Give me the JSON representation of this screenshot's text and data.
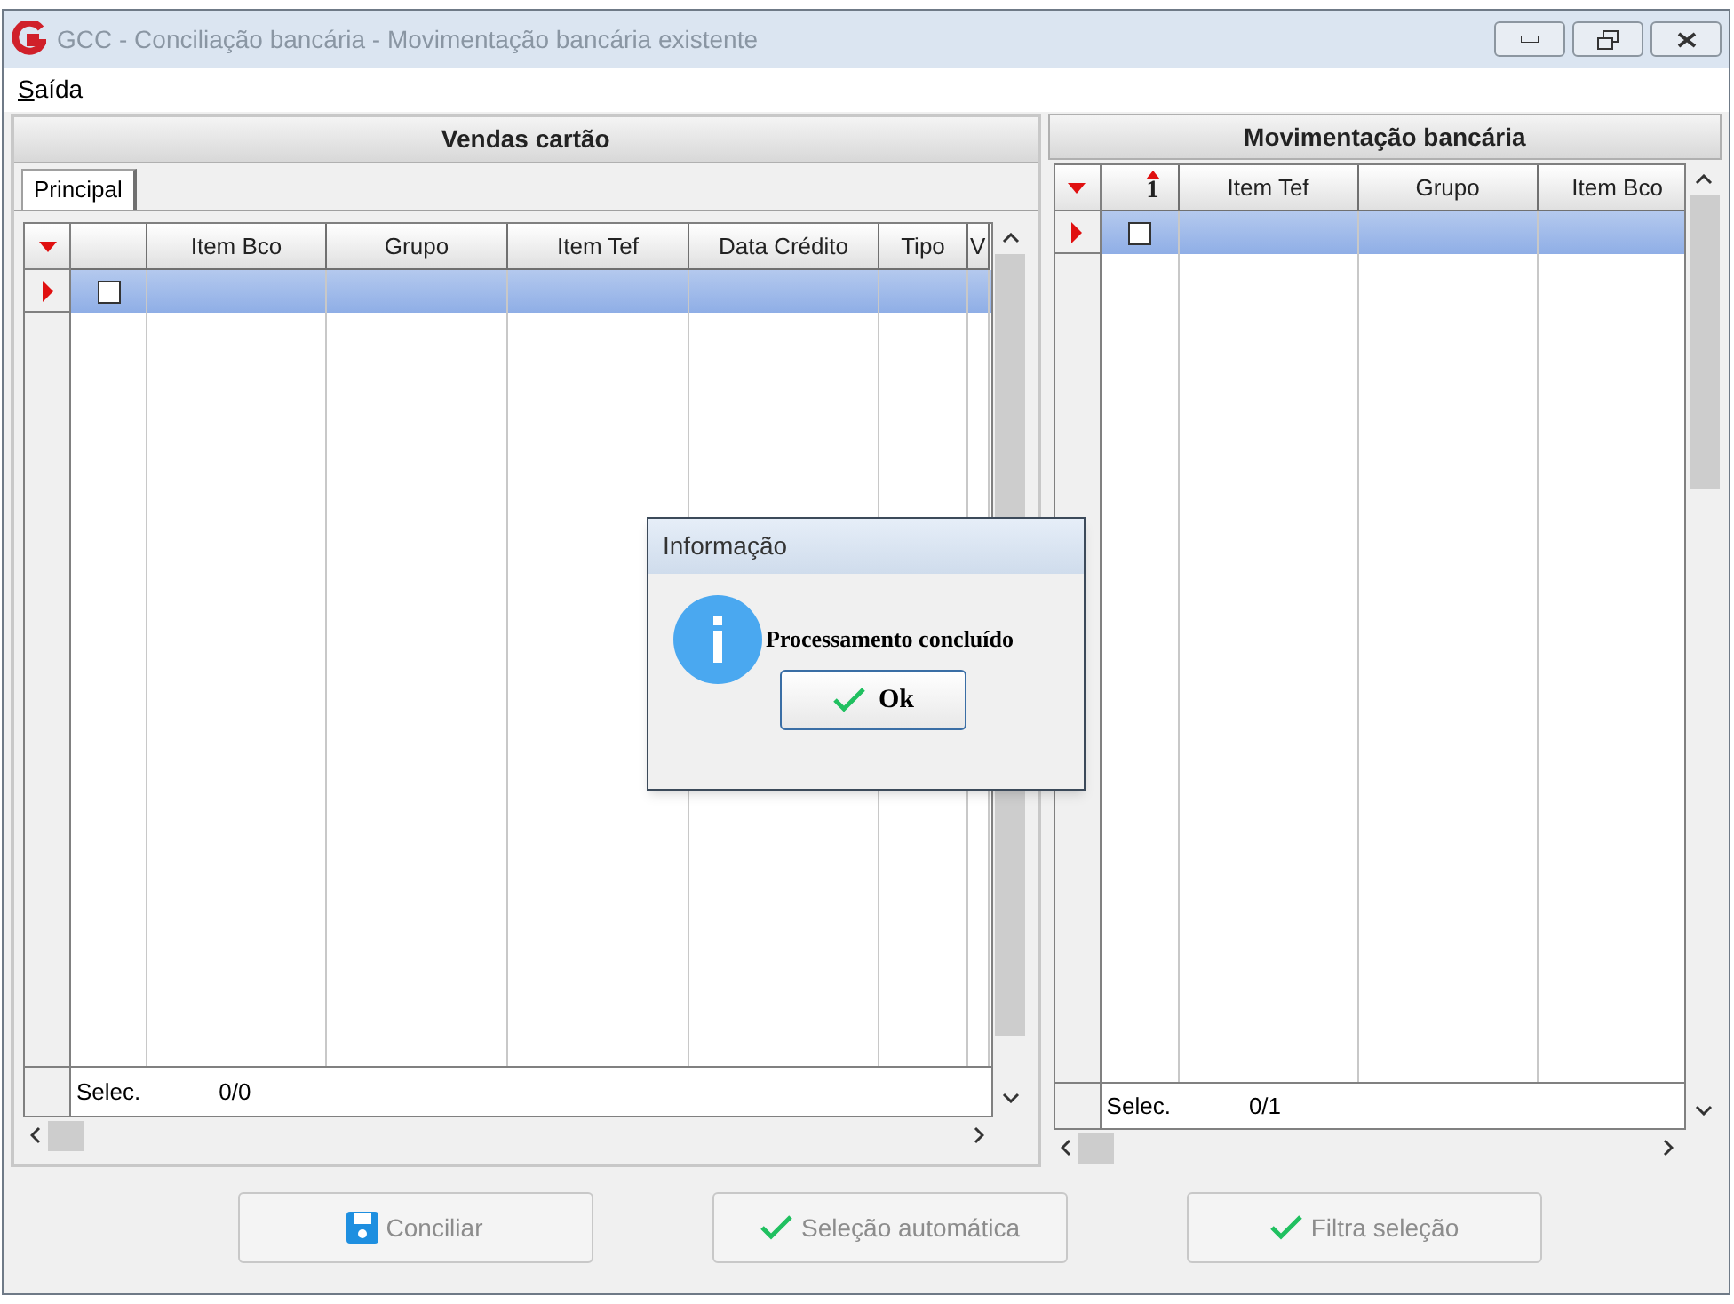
{
  "window": {
    "title": "GCC - Conciliação bancária - Movimentação bancária existente"
  },
  "menu": [
    {
      "label": "Saída"
    }
  ],
  "left_panel": {
    "title": "Vendas cartão",
    "tabs": [
      {
        "label": "Principal",
        "selected": true
      }
    ],
    "grid": {
      "columns": [
        {
          "kind": "blank"
        },
        {
          "kind": "text",
          "label": "Item Bco"
        },
        {
          "kind": "text",
          "label": "Grupo"
        },
        {
          "kind": "text",
          "label": "Item Tef"
        },
        {
          "kind": "text",
          "label": "Data Crédito"
        },
        {
          "kind": "text",
          "label": "Tipo"
        },
        {
          "kind": "text",
          "label": "V"
        }
      ],
      "rows": [
        {
          "current": true,
          "checked": false
        }
      ],
      "footer": {
        "label": "Selec.",
        "count": "0/0"
      }
    }
  },
  "right_panel": {
    "title": "Movimentação bancária",
    "grid": {
      "columns": [
        {
          "kind": "sort",
          "label": "1"
        },
        {
          "kind": "text",
          "label": "Item Tef"
        },
        {
          "kind": "text",
          "label": "Grupo"
        },
        {
          "kind": "text",
          "label": "Item Bco"
        }
      ],
      "rows": [
        {
          "current": true,
          "checked": false
        }
      ],
      "footer": {
        "label": "Selec.",
        "count": "0/1"
      }
    }
  },
  "dialog": {
    "title": "Informação",
    "message": "Processamento concluído",
    "button": "Ok"
  },
  "buttons": [
    {
      "label": "Conciliar",
      "kind": "save",
      "disabled": true
    },
    {
      "label": "Seleção automática",
      "kind": "apply",
      "disabled": true
    },
    {
      "label": "Filtra seleção",
      "kind": "apply",
      "disabled": true
    }
  ]
}
